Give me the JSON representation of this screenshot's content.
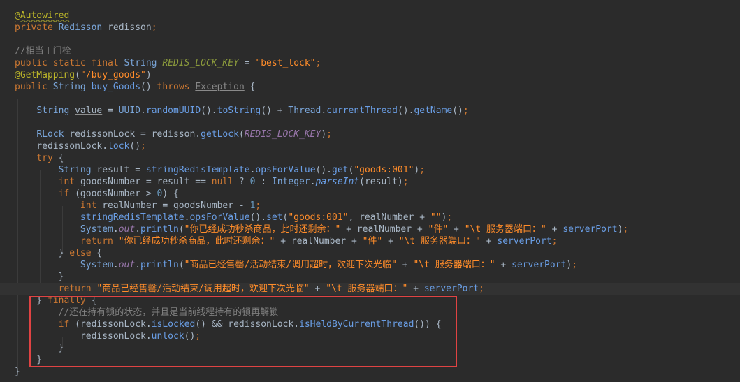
{
  "editor": {
    "language": "java",
    "theme_background": "#2b2b2b",
    "highlight_color": "#e04343",
    "current_line": 25,
    "lines": [
      "@Autowired",
      "private Redisson redisson;",
      "",
      "//相当于门栓",
      "public static final String REDIS_LOCK_KEY = \"best_lock\";",
      "@GetMapping(\"/buy_goods\")",
      "public String buy_Goods() throws Exception {",
      "",
      "    String value = UUID.randomUUID().toString() + Thread.currentThread().getName();",
      "",
      "    RLock redissonLock = redisson.getLock(REDIS_LOCK_KEY);",
      "    redissonLock.lock();",
      "    try {",
      "        String result = stringRedisTemplate.opsForValue().get(\"goods:001\");",
      "        int goodsNumber = result == null ? 0 : Integer.parseInt(result);",
      "        if (goodsNumber > 0) {",
      "            int realNumber = goodsNumber - 1;",
      "            stringRedisTemplate.opsForValue().set(\"goods:001\", realNumber + \"\");",
      "            System.out.println(\"你已经成功秒杀商品，此时还剩余：\" + realNumber + \"件\" + \"\\t 服务器端口：\" + serverPort);",
      "            return \"你已经成功秒杀商品，此时还剩余：\" + realNumber + \"件\" + \"\\t 服务器端口：\" + serverPort;",
      "        } else {",
      "            System.out.println(\"商品已经售罄/活动结束/调用超时，欢迎下次光临\" + \"\\t 服务器端口：\" + serverPort);",
      "        }",
      "        return \"商品已经售罄/活动结束/调用超时，欢迎下次光临\" + \"\\t 服务器端口：\" + serverPort;",
      "    } finally {",
      "        //还在持有锁的状态，并且是当前线程持有的锁再解锁",
      "        if (redissonLock.isLocked() && redissonLock.isHeldByCurrentThread()) {",
      "            redissonLock.unlock();",
      "        }",
      "    }",
      "}"
    ]
  }
}
